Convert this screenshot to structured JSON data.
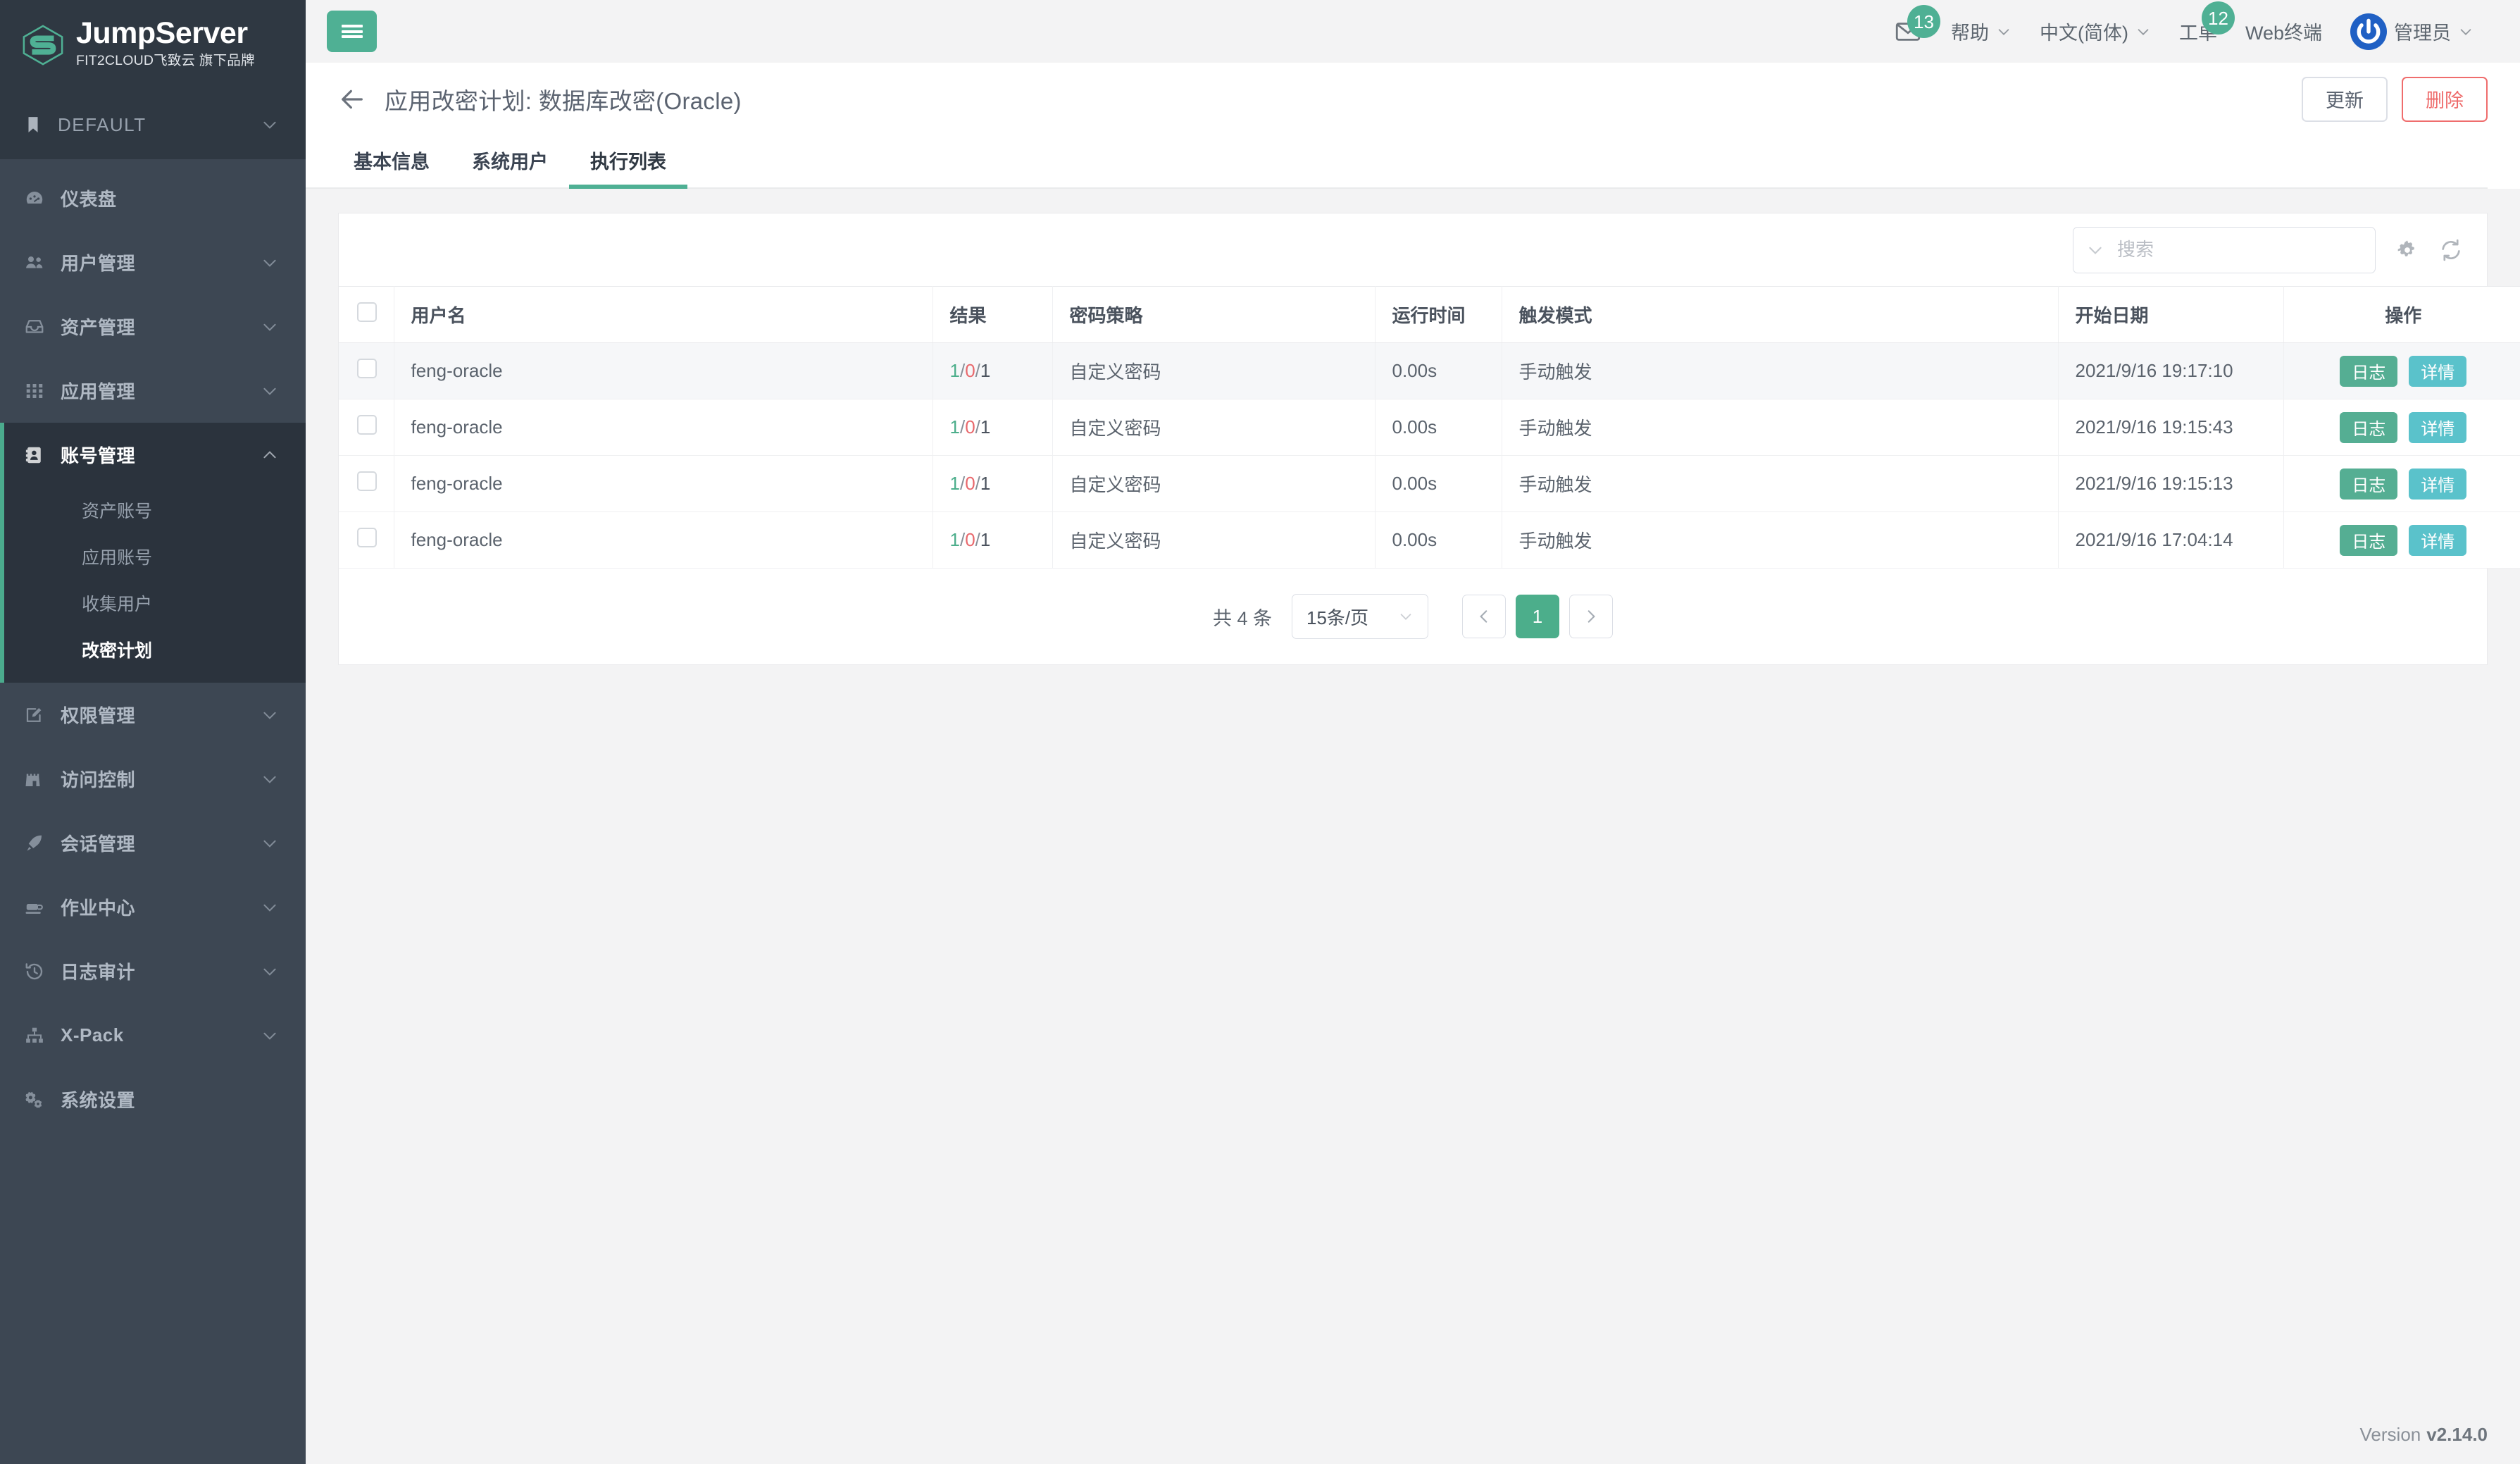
{
  "brand": {
    "title": "JumpServer",
    "subtitle": "FIT2CLOUD飞致云 旗下品牌",
    "logo_icon": "jumpserver-logo-icon"
  },
  "sidebar": {
    "org": {
      "label": "DEFAULT",
      "icon": "bookmark-icon",
      "chevron": "chevron-down-icon"
    },
    "items": [
      {
        "label": "仪表盘",
        "icon": "dashboard-icon",
        "expandable": false,
        "active": false
      },
      {
        "label": "用户管理",
        "icon": "users-icon",
        "expandable": true,
        "active": false
      },
      {
        "label": "资产管理",
        "icon": "inbox-icon",
        "expandable": true,
        "active": false
      },
      {
        "label": "应用管理",
        "icon": "grid-icon",
        "expandable": true,
        "active": false
      },
      {
        "label": "账号管理",
        "icon": "contact-card-icon",
        "expandable": true,
        "active": true,
        "children": [
          {
            "label": "资产账号",
            "active": false
          },
          {
            "label": "应用账号",
            "active": false
          },
          {
            "label": "收集用户",
            "active": false
          },
          {
            "label": "改密计划",
            "active": true
          }
        ]
      },
      {
        "label": "权限管理",
        "icon": "edit-square-icon",
        "expandable": true,
        "active": false
      },
      {
        "label": "访问控制",
        "icon": "castle-icon",
        "expandable": true,
        "active": false
      },
      {
        "label": "会话管理",
        "icon": "rocket-icon",
        "expandable": true,
        "active": false
      },
      {
        "label": "作业中心",
        "icon": "coffee-icon",
        "expandable": true,
        "active": false
      },
      {
        "label": "日志审计",
        "icon": "history-icon",
        "expandable": true,
        "active": false
      },
      {
        "label": "X-Pack",
        "icon": "sitemap-icon",
        "expandable": true,
        "active": false
      },
      {
        "label": "系统设置",
        "icon": "gears-icon",
        "expandable": false,
        "active": false
      }
    ]
  },
  "topbar": {
    "menu_toggle_icon": "hamburger-icon",
    "mail": {
      "icon": "envelope-icon",
      "badge": "13"
    },
    "help": {
      "label": "帮助",
      "chevron": "chevron-down-icon"
    },
    "language": {
      "label": "中文(简体)",
      "chevron": "chevron-down-icon"
    },
    "tickets": {
      "label": "工单",
      "badge": "12"
    },
    "webterminal": {
      "label": "Web终端"
    },
    "user": {
      "label": "管理员",
      "chevron": "chevron-down-icon",
      "avatar_icon": "power-avatar-icon"
    }
  },
  "page": {
    "back_icon": "arrow-left-icon",
    "title": "应用改密计划: 数据库改密(Oracle)",
    "update_label": "更新",
    "delete_label": "删除",
    "tabs": [
      {
        "label": "基本信息",
        "active": false
      },
      {
        "label": "系统用户",
        "active": false
      },
      {
        "label": "执行列表",
        "active": true
      }
    ]
  },
  "toolbar": {
    "search_placeholder": "搜索",
    "search_value": "",
    "filter_chevron_icon": "chevron-down-icon",
    "settings_icon": "gear-icon",
    "refresh_icon": "refresh-icon"
  },
  "table": {
    "select_all_checked": false,
    "columns": [
      "用户名",
      "结果",
      "密码策略",
      "运行时间",
      "触发模式",
      "开始日期",
      "操作"
    ],
    "rows": [
      {
        "checked": false,
        "username": "feng-oracle",
        "result_ok": "1",
        "result_fail": "0",
        "result_total": "1",
        "policy": "自定义密码",
        "runtime": "0.00s",
        "trigger": "手动触发",
        "date": "2021/9/16 19:17:10"
      },
      {
        "checked": false,
        "username": "feng-oracle",
        "result_ok": "1",
        "result_fail": "0",
        "result_total": "1",
        "policy": "自定义密码",
        "runtime": "0.00s",
        "trigger": "手动触发",
        "date": "2021/9/16 19:15:43"
      },
      {
        "checked": false,
        "username": "feng-oracle",
        "result_ok": "1",
        "result_fail": "0",
        "result_total": "1",
        "policy": "自定义密码",
        "runtime": "0.00s",
        "trigger": "手动触发",
        "date": "2021/9/16 19:15:13"
      },
      {
        "checked": false,
        "username": "feng-oracle",
        "result_ok": "1",
        "result_fail": "0",
        "result_total": "1",
        "policy": "自定义密码",
        "runtime": "0.00s",
        "trigger": "手动触发",
        "date": "2021/9/16 17:04:14"
      }
    ],
    "row_actions": {
      "log_label": "日志",
      "detail_label": "详情"
    }
  },
  "pagination": {
    "total_text": "共 4 条",
    "page_size": "15条/页",
    "page_size_chevron_icon": "chevron-down-icon",
    "prev_icon": "chevron-left-icon",
    "next_icon": "chevron-right-icon",
    "pages": [
      "1"
    ],
    "current_page": "1"
  },
  "footer": {
    "version_label": "Version",
    "version_value": "v2.14.0"
  },
  "colors": {
    "brand_green": "#4fb094",
    "sidebar_bg": "#3d4753",
    "sidebar_dark": "#2f3842",
    "active_green": "#4cae8b",
    "danger_red": "#ee6a6a",
    "tag_log": "#55ae93",
    "tag_detail": "#5ac2cb",
    "avatar_blue": "#2060c4"
  }
}
